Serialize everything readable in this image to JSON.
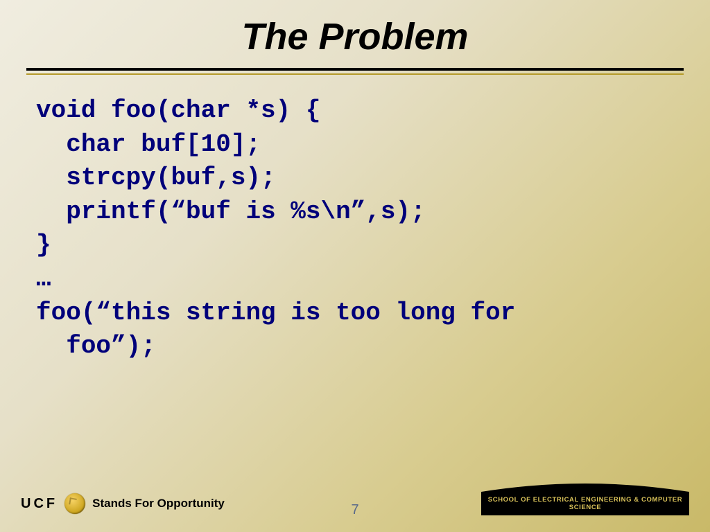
{
  "slide": {
    "title": "The Problem",
    "page_number": "7"
  },
  "code": {
    "lines": [
      "void foo(char *s) {",
      "  char buf[10];",
      "  strcpy(buf,s);",
      "  printf(“buf is %s\\n”,s);",
      "}",
      "…",
      "foo(“this string is too long for",
      "  foo”);"
    ]
  },
  "footer": {
    "ucf": "UCF",
    "tagline": "Stands For Opportunity",
    "department": "SCHOOL OF ELECTRICAL ENGINEERING & COMPUTER SCIENCE"
  }
}
